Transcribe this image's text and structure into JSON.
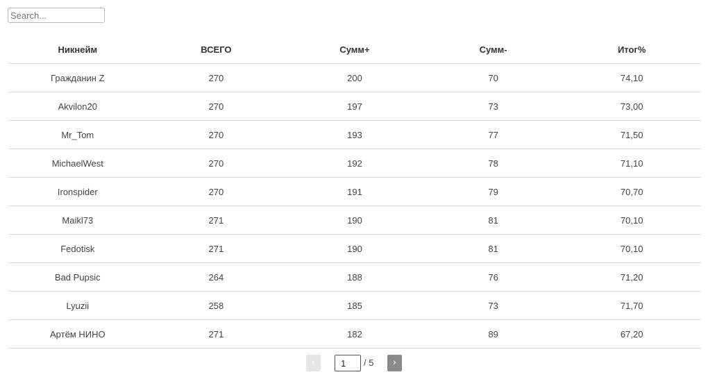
{
  "search": {
    "placeholder": "Search...",
    "value": ""
  },
  "table": {
    "columns": [
      "Никнейм",
      "ВСЕГО",
      "Сумм+",
      "Сумм-",
      "Итог%"
    ],
    "rows": [
      [
        "Гражданин Z",
        "270",
        "200",
        "70",
        "74,10"
      ],
      [
        "Akvilon20",
        "270",
        "197",
        "73",
        "73,00"
      ],
      [
        "Mr_Tom",
        "270",
        "193",
        "77",
        "71,50"
      ],
      [
        "MichaelWest",
        "270",
        "192",
        "78",
        "71,10"
      ],
      [
        "Ironspider",
        "270",
        "191",
        "79",
        "70,70"
      ],
      [
        "Maikl73",
        "271",
        "190",
        "81",
        "70,10"
      ],
      [
        "Fedotisk",
        "271",
        "190",
        "81",
        "70,10"
      ],
      [
        "Bad Pupsic",
        "264",
        "188",
        "76",
        "71,20"
      ],
      [
        "Lyuzii",
        "258",
        "185",
        "73",
        "71,70"
      ],
      [
        "Артём НИНО",
        "271",
        "182",
        "89",
        "67,20"
      ]
    ]
  },
  "pagination": {
    "prev_icon": "‹",
    "next_icon": "›",
    "current_page": "1",
    "total_label": "/ 5"
  }
}
